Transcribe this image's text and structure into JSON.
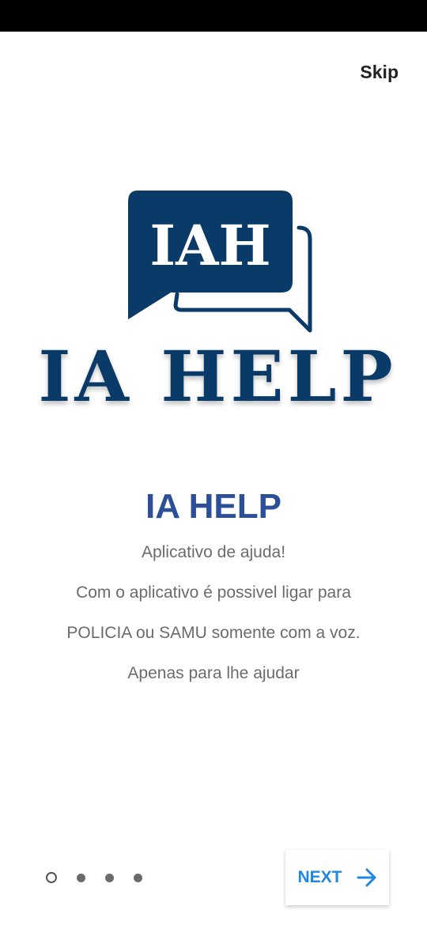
{
  "header": {
    "skip_label": "Skip"
  },
  "logo": {
    "badge_text": "IAH",
    "wordmark": "IA HELP",
    "color": "#0a3a68"
  },
  "content": {
    "title": "IA HELP",
    "lines": [
      "Aplicativo de ajuda!",
      "Com o aplicativo é possivel ligar para",
      "POLICIA ou SAMU somente com a voz.",
      "Apenas para lhe ajudar"
    ]
  },
  "pager": {
    "total_pages": 4,
    "current_page": 1
  },
  "footer": {
    "next_label": "NEXT",
    "next_icon": "arrow-right-icon",
    "accent_color": "#1f87e0"
  }
}
